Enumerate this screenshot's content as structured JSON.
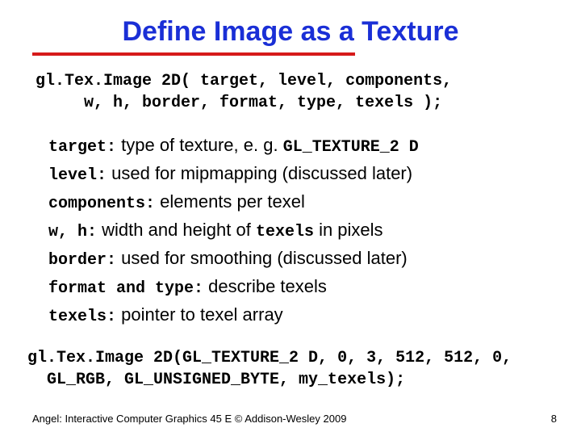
{
  "title": "Define  Image as a Texture",
  "sig_line1": "gl.Tex.Image 2D( target, level, components,",
  "sig_line2": "     w, h, border, format, type, texels );",
  "params": {
    "target_key": "target:",
    "target_pre": " type of texture, e. g. ",
    "target_eg": "GL_TEXTURE_2 D",
    "level_key": "level:",
    "level_desc": " used for mipmapping (discussed later)",
    "components_key": "components:",
    "components_desc": " elements per texel",
    "wh_key": "w, h:",
    "wh_pre": " width and height of ",
    "wh_mid": "texels",
    "wh_post": " in pixels",
    "border_key": "border:",
    "border_desc": " used for smoothing (discussed later)",
    "ft_key": "format and type:",
    "ft_desc": " describe texels",
    "texels_key": "texels:",
    "texels_desc": " pointer to texel array"
  },
  "example_line1": "gl.Tex.Image 2D(GL_TEXTURE_2 D, 0, 3, 512, 512, 0,",
  "example_line2": "  GL_RGB, GL_UNSIGNED_BYTE, my_texels);",
  "footer": "Angel: Interactive Computer Graphics 45 E © Addison-Wesley 2009",
  "page": "8"
}
